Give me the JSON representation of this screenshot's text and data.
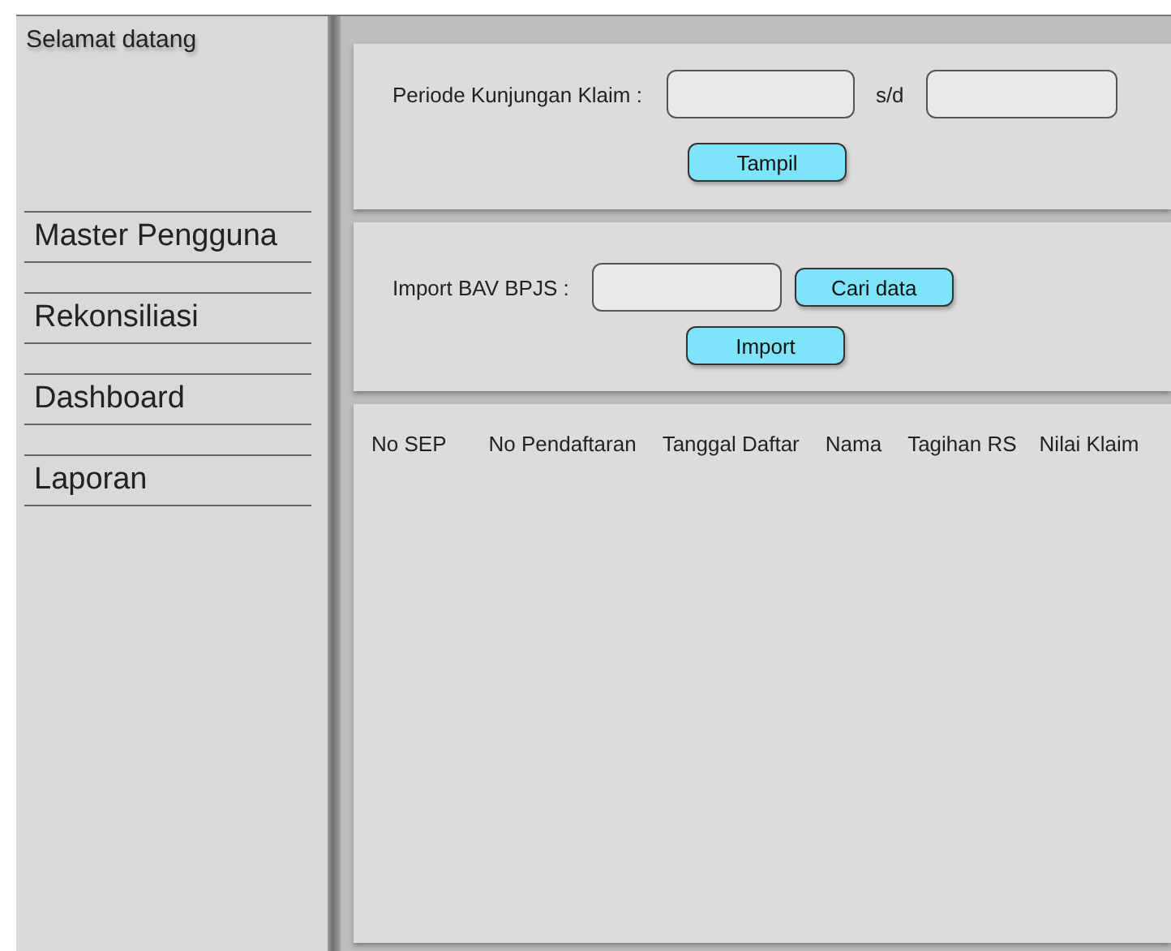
{
  "sidebar": {
    "greeting": "Selamat datang",
    "items": [
      {
        "label": "Master Pengguna"
      },
      {
        "label": "Rekonsiliasi"
      },
      {
        "label": "Dashboard"
      },
      {
        "label": "Laporan"
      }
    ]
  },
  "period_form": {
    "label": "Periode Kunjungan Klaim :",
    "separator": "s/d",
    "button": "Tampil"
  },
  "import_form": {
    "label": "Import BAV BPJS :",
    "search_button": "Cari data",
    "import_button": "Import"
  },
  "table": {
    "columns": [
      "No SEP",
      "No Pendaftaran",
      "Tanggal Daftar",
      "Nama",
      "Tagihan RS",
      "Nilai Klaim"
    ]
  }
}
